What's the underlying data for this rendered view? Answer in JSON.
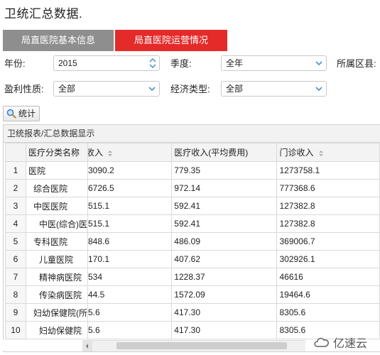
{
  "page_title": "卫统汇总数据.",
  "tabs": [
    {
      "label": "局直医院基本信息",
      "active": false
    },
    {
      "label": "局直医院运营情况",
      "active": true
    }
  ],
  "filters": {
    "year_label": "年份:",
    "year_value": "2015",
    "season_label": "季度:",
    "season_value": "全年",
    "district_label": "所属区县:",
    "profit_label": "盈利性质:",
    "profit_value": "全部",
    "economy_label": "经济类型:",
    "economy_value": "全部"
  },
  "stat_button": {
    "label": "统计",
    "icon": "search-icon"
  },
  "panel_title": "卫统报表/汇总数据显示",
  "table": {
    "columns": [
      "医疗分类名称",
      "收入",
      "医疗收入(平均费用)",
      "门诊收入"
    ],
    "rows": [
      {
        "no": "1",
        "name": "医院",
        "indent": 0,
        "income": "3090.2",
        "avg": "779.35",
        "outpatient": "1273758.1"
      },
      {
        "no": "2",
        "name": "综合医院",
        "indent": 1,
        "income": "6726.5",
        "avg": "972.14",
        "outpatient": "777368.6"
      },
      {
        "no": "3",
        "name": "中医医院",
        "indent": 1,
        "income": "515.1",
        "avg": "592.41",
        "outpatient": "127382.8"
      },
      {
        "no": "4",
        "name": "中医(综合)医",
        "indent": 2,
        "income": "515.1",
        "avg": "592.41",
        "outpatient": "127382.8"
      },
      {
        "no": "5",
        "name": "专科医院",
        "indent": 1,
        "income": "848.6",
        "avg": "486.09",
        "outpatient": "369006.7"
      },
      {
        "no": "6",
        "name": "儿童医院",
        "indent": 2,
        "income": "170.1",
        "avg": "407.62",
        "outpatient": "302926.1"
      },
      {
        "no": "7",
        "name": "精神病医院",
        "indent": 2,
        "income": "534",
        "avg": "1228.37",
        "outpatient": "46616"
      },
      {
        "no": "8",
        "name": "传染病医院",
        "indent": 2,
        "income": "44.5",
        "avg": "1572.09",
        "outpatient": "19464.6"
      },
      {
        "no": "9",
        "name": "妇幼保健院(所",
        "indent": 1,
        "income": "5.6",
        "avg": "417.30",
        "outpatient": "8305.6"
      },
      {
        "no": "10",
        "name": "妇幼保健院",
        "indent": 2,
        "income": "5.6",
        "avg": "417.30",
        "outpatient": "8305.6"
      }
    ]
  },
  "watermark": "亿速云",
  "colors": {
    "active_tab": "#e52a2a",
    "inactive_tab": "#8e8e8e"
  }
}
